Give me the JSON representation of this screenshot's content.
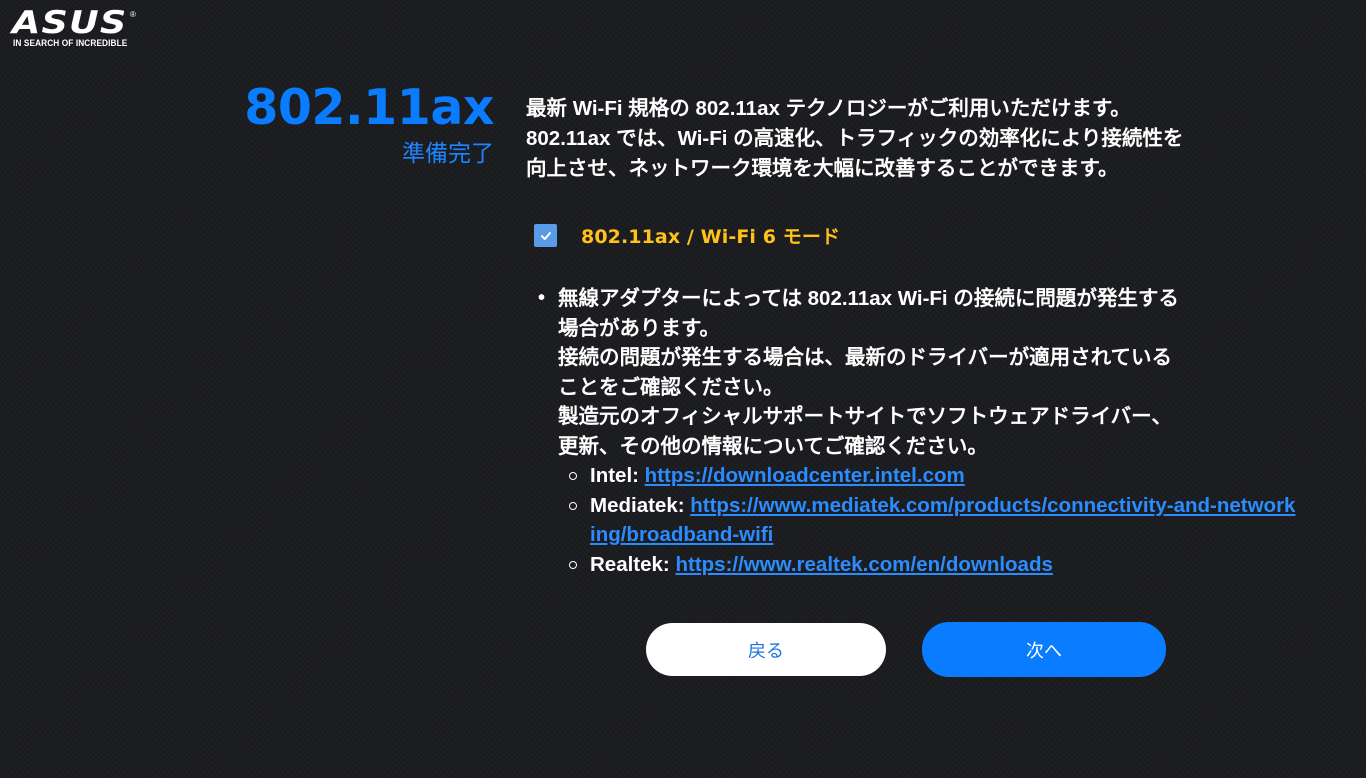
{
  "logo": {
    "brand": "ASUS",
    "registered_mark": "®",
    "tagline": "IN SEARCH OF INCREDIBLE"
  },
  "header": {
    "title": "802.11ax",
    "subtitle": "準備完了"
  },
  "description": {
    "lines": [
      "最新 Wi-Fi 規格の 802.11ax テクノロジーがご利用いただけます。",
      "802.11ax では、Wi-Fi の高速化、トラフィックの効率化により接続性を",
      "向上させ、ネットワーク環境を大幅に改善することができます。"
    ]
  },
  "option": {
    "label": "802.11ax / Wi-Fi 6 モード",
    "checked": true,
    "check_icon": "check-icon"
  },
  "notes": {
    "bullet": "•",
    "lines": [
      "無線アダプターによっては 802.11ax Wi-Fi の接続に問題が発生する",
      "場合があります。",
      "接続の問題が発生する場合は、最新のドライバーが適用されている",
      "ことをご確認ください。",
      "製造元のオフィシャルサポートサイトでソフトウェアドライバー、",
      "更新、その他の情報についてご確認ください。"
    ],
    "vendors": [
      {
        "name": "Intel:",
        "url": "https://downloadcenter.intel.com"
      },
      {
        "name": "Mediatek:",
        "url": "https://www.mediatek.com/products/connectivity-and-networking/broadband-wifi"
      },
      {
        "name": "Realtek:",
        "url": "https://www.realtek.com/en/downloads"
      }
    ]
  },
  "buttons": {
    "back_label": "戻る",
    "next_label": "次へ"
  },
  "colors": {
    "accent": "#0a7cff",
    "option_label": "#ffc21a",
    "link": "#2b8cff",
    "background": "#1c1d20"
  }
}
